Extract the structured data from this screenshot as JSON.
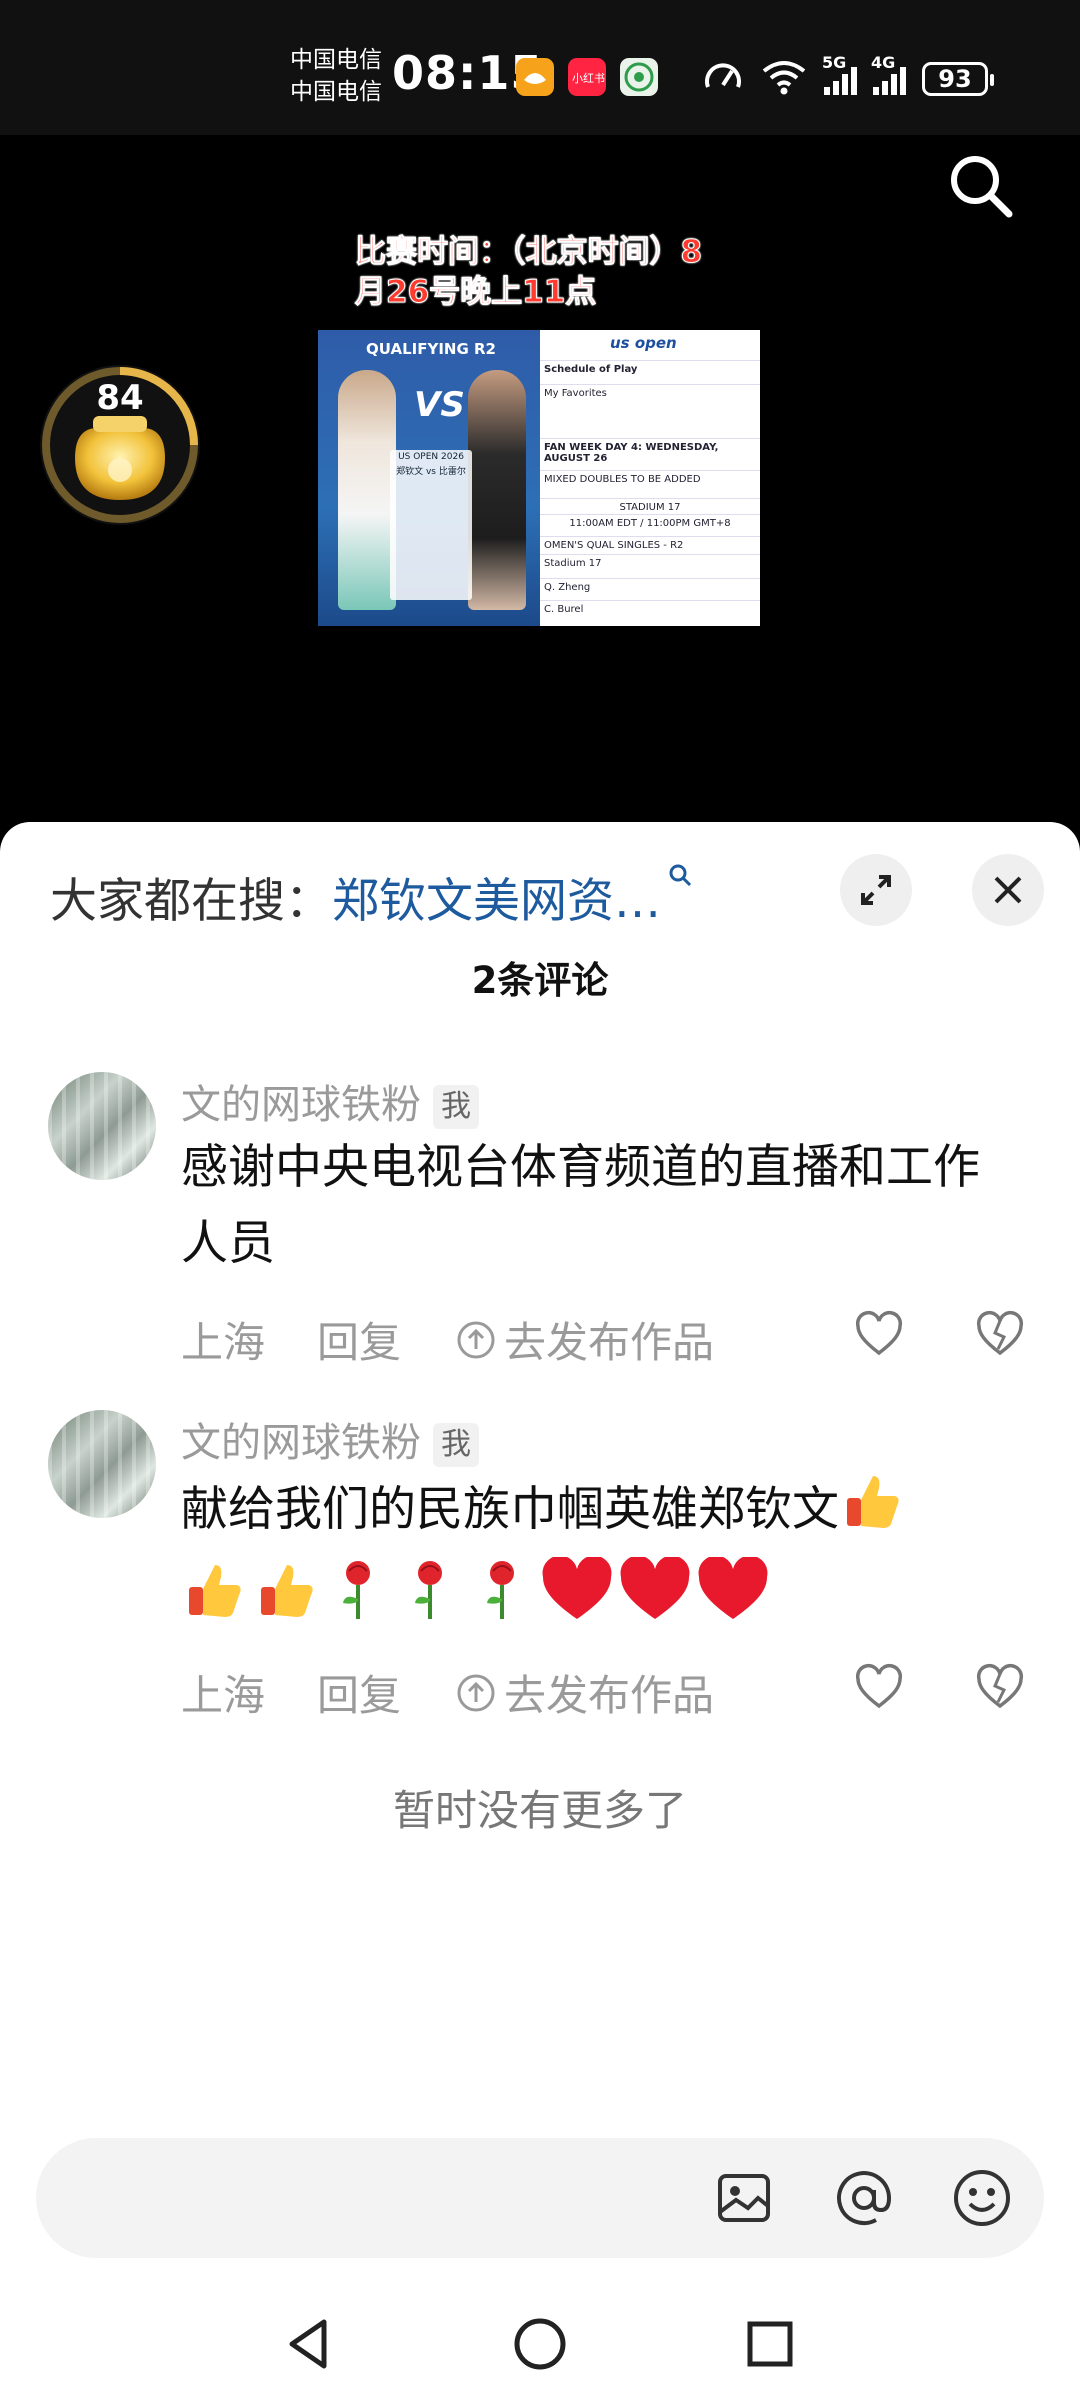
{
  "status_bar": {
    "carrier_1": "中国电信",
    "carrier_2": "中国电信",
    "time": "08:15",
    "network_1": "5G",
    "network_2": "4G",
    "battery": "93",
    "app_badges": [
      "taobao-like orange app",
      "小红书",
      "green app"
    ]
  },
  "video": {
    "match_time": "比赛时间：（北京时间）8月26号晚上11点",
    "coin_count": "84",
    "poster": {
      "qualifying": "QUALIFYING R2",
      "vs": "VS",
      "card_title": "US OPEN 2026",
      "card_sub": "郑钦文 vs 比雷尔",
      "schedule_header": "Schedule of Play",
      "my_favorites": "My Favorites",
      "fan_week": "FAN WEEK DAY 4: WEDNESDAY, AUGUST 26",
      "mixed": "MIXED DOUBLES TO BE ADDED",
      "stadium": "STADIUM 17",
      "time_line": "11:00AM EDT / 11:00PM GMT+8",
      "womens": "OMEN'S QUAL SINGLES - R2",
      "stadium_row": "Stadium 17",
      "player1": "Q. Zheng",
      "player2": "C. Burel",
      "logo": "us open"
    }
  },
  "sheet": {
    "trend_prefix": "大家都在搜：",
    "trend_keyword": "郑钦文美网资…",
    "comments_title": "2条评论",
    "comments": [
      {
        "username": "文的网球铁粉",
        "tag": "我",
        "text": "感谢中央电视台体育频道的直播和工作人员",
        "location": "上海",
        "reply": "回复",
        "publish": "去发布作品"
      },
      {
        "username": "文的网球铁粉",
        "tag": "我",
        "text": "献给我们的民族巾帼英雄郑钦文",
        "emojis": [
          "thumbs-up",
          "thumbs-up",
          "thumbs-up",
          "rose",
          "rose",
          "rose",
          "heart",
          "heart",
          "heart"
        ],
        "location": "上海",
        "reply": "回复",
        "publish": "去发布作品"
      }
    ],
    "no_more": "暂时没有更多了",
    "input_placeholder": "",
    "icons": {
      "image": "image-icon",
      "mention": "at-icon",
      "emoji": "emoji-icon"
    }
  },
  "colors": {
    "keyword": "#1e5a9e",
    "match_time": "#ff3b30",
    "heart": "#e8192c"
  }
}
